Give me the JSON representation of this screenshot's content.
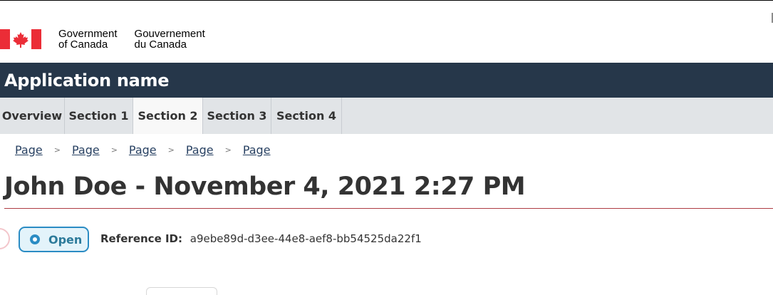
{
  "header": {
    "gov_en_line1": "Government",
    "gov_en_line2": "of Canada",
    "gov_fr_line1": "Gouvernement",
    "gov_fr_line2": "du Canada"
  },
  "app": {
    "name": "Application name"
  },
  "nav": {
    "items": [
      "Overview",
      "Section 1",
      "Section 2",
      "Section 3",
      "Section 4"
    ],
    "active": "Section 2"
  },
  "breadcrumb": {
    "items": [
      "Page",
      "Page",
      "Page",
      "Page",
      "Page"
    ],
    "separator": ">"
  },
  "page": {
    "title": "John Doe - November 4, 2021 2:27 PM"
  },
  "status": {
    "label": "Open"
  },
  "reference": {
    "label": "Reference ID:",
    "value": "a9ebe89d-d3ee-44e8-aef8-bb54525da22f1"
  },
  "colors": {
    "app_bar": "#26374a",
    "nav_bg": "#e1e4e7",
    "title_rule": "#af3c43",
    "badge_border": "#2b8cc4",
    "flag_red": "#eb2d37"
  }
}
